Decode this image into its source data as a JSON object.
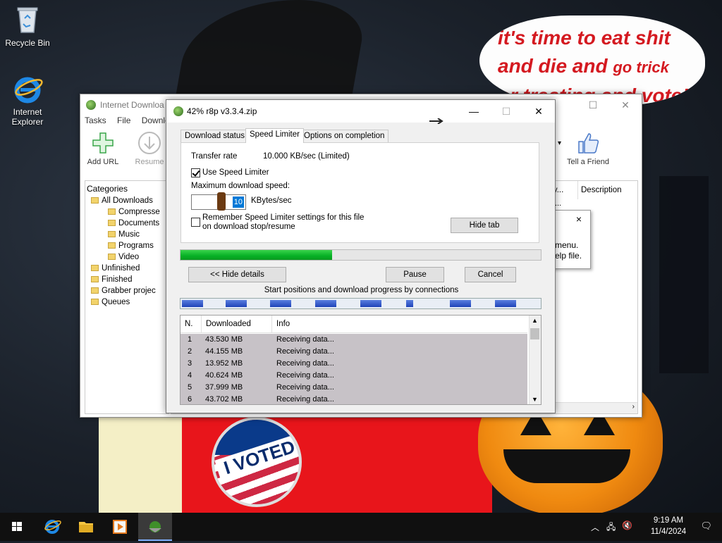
{
  "desktop": {
    "icons": [
      {
        "label": "Recycle Bin"
      },
      {
        "label": "Internet\nExplorer"
      }
    ],
    "wallpaper_text": {
      "line1": "it's time to eat shit",
      "line2a": "and die and ",
      "line2b": "go trick",
      "line3": "or treating and vote!",
      "pin_text": "I VOTED"
    }
  },
  "idm_main": {
    "title": "Internet Downloa",
    "menu": [
      "Tasks",
      "File",
      "Downloa"
    ],
    "toolbar": {
      "add_url": "Add URL",
      "resume": "Resume",
      "tell_friend": "Tell a Friend"
    },
    "categories_title": "Categories",
    "tree": [
      {
        "label": "All Downloads",
        "level": 0
      },
      {
        "label": "Compresse",
        "level": 1
      },
      {
        "label": "Documents",
        "level": 1
      },
      {
        "label": "Music",
        "level": 1
      },
      {
        "label": "Programs",
        "level": 1
      },
      {
        "label": "Video",
        "level": 1
      },
      {
        "label": "Unfinished",
        "level": 0
      },
      {
        "label": "Finished",
        "level": 0
      },
      {
        "label": "Grabber projec",
        "level": 0
      },
      {
        "label": "Queues",
        "level": 0
      }
    ],
    "list_headers": [
      "ry...",
      "Description"
    ],
    "list_row_partial": "...",
    "popup": {
      "line1": "menu.",
      "line2": "elp file.",
      "close": "×"
    }
  },
  "dialog": {
    "title": "42% r8p v3.3.4.zip",
    "tabs": [
      "Download status",
      "Speed Limiter",
      "Options on completion"
    ],
    "active_tab": "Speed Limiter",
    "transfer_rate_label": "Transfer rate",
    "transfer_rate_value": "10.000  KB/sec  (Limited)",
    "use_limiter_label": "Use Speed Limiter",
    "use_limiter_checked": true,
    "max_speed_label": "Maximum download speed:",
    "max_speed_value": "10",
    "max_speed_unit": "KBytes/sec",
    "remember_label_1": "Remember Speed Limiter settings for this file",
    "remember_label_2": "on download stop/resume",
    "remember_checked": false,
    "hide_tab_button": "Hide tab",
    "progress_fraction": 0.42,
    "hide_details_button": "<< Hide details",
    "pause_button": "Pause",
    "cancel_button": "Cancel",
    "connections_caption": "Start positions and download progress by connections",
    "table_headers": [
      "N.",
      "Downloaded",
      "Info"
    ],
    "connections": [
      {
        "n": "1",
        "downloaded": "43.530  MB",
        "info": "Receiving data..."
      },
      {
        "n": "2",
        "downloaded": "44.155  MB",
        "info": "Receiving data..."
      },
      {
        "n": "3",
        "downloaded": "13.952  MB",
        "info": "Receiving data..."
      },
      {
        "n": "4",
        "downloaded": "40.624  MB",
        "info": "Receiving data..."
      },
      {
        "n": "5",
        "downloaded": "37.999  MB",
        "info": "Receiving data..."
      },
      {
        "n": "6",
        "downloaded": "43.702  MB",
        "info": "Receiving data..."
      }
    ]
  },
  "taskbar": {
    "time": "9:19 AM",
    "date": "11/4/2024"
  },
  "colors": {
    "progress_green": "#06b025",
    "selection_blue": "#0078d7",
    "row_gray": "#c7c2c7",
    "taskbar": "#101010"
  }
}
